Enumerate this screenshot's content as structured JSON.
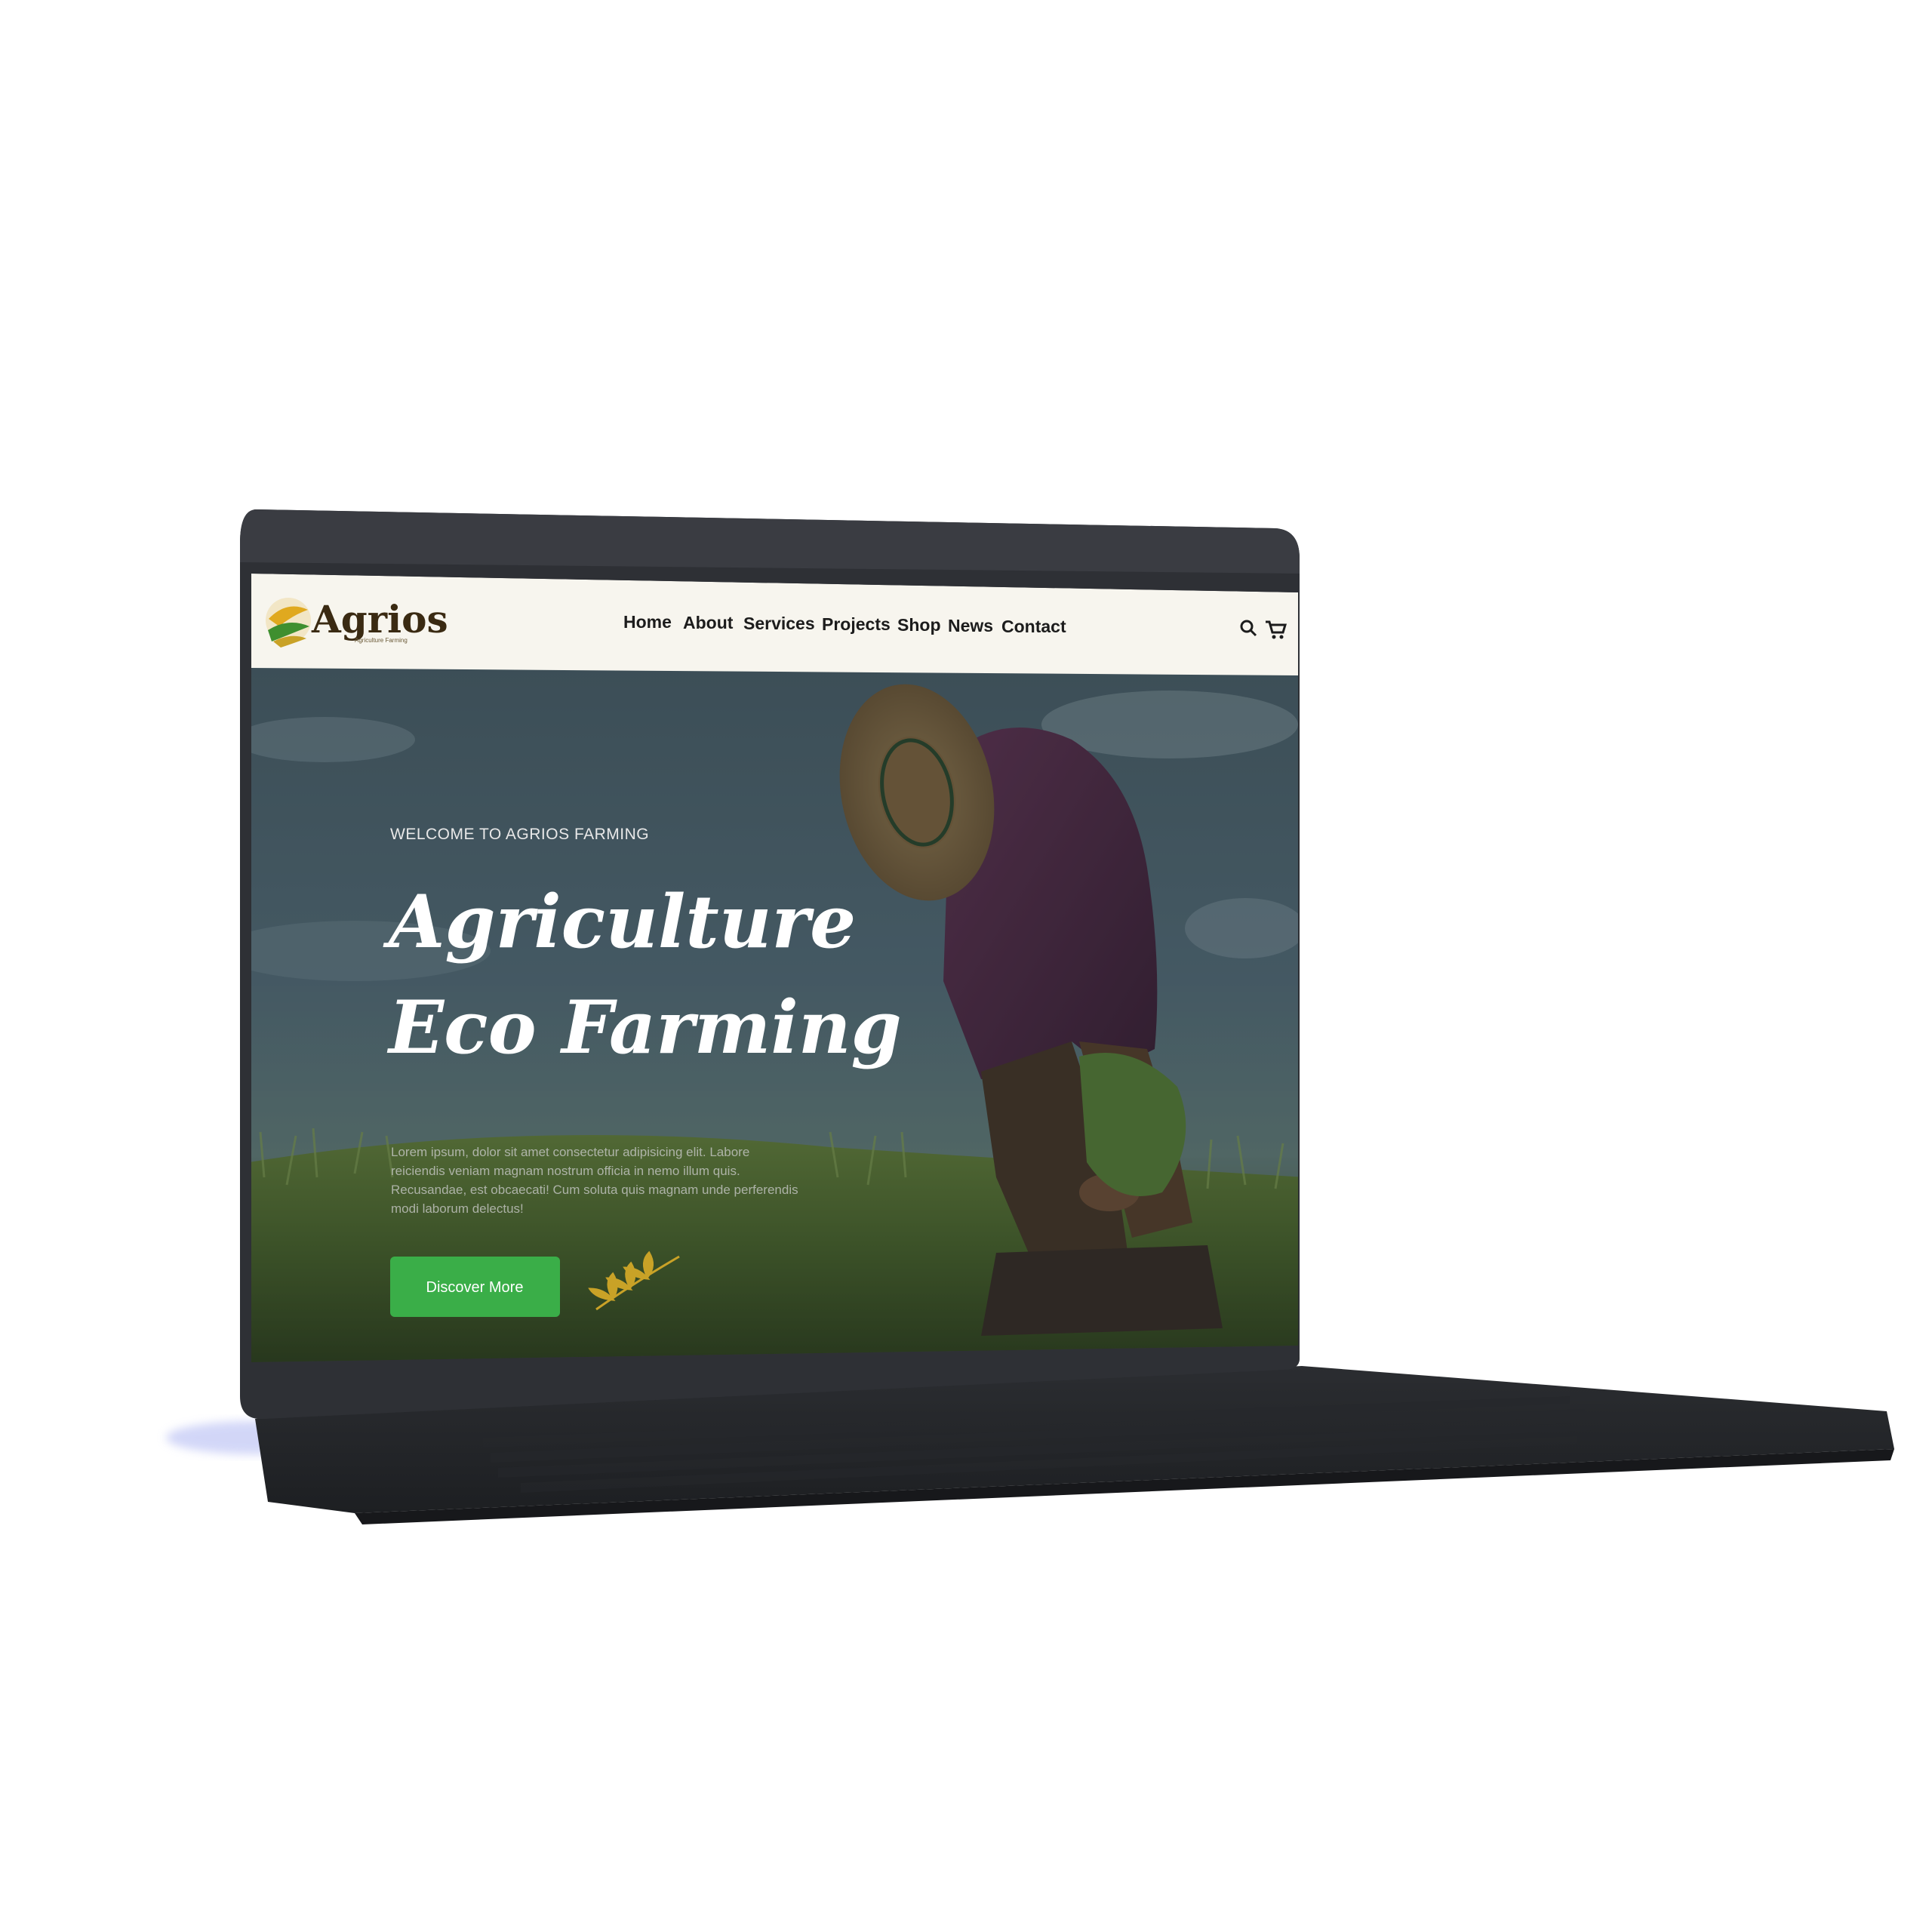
{
  "site": {
    "brand": "Agrios",
    "brand_subtitle": "Agriculture Farming"
  },
  "nav": {
    "items": [
      {
        "label": "Home"
      },
      {
        "label": "About"
      },
      {
        "label": "Services"
      },
      {
        "label": "Projects"
      },
      {
        "label": "Shop"
      },
      {
        "label": "News"
      },
      {
        "label": "Contact"
      }
    ],
    "icons": [
      "search-icon",
      "cart-icon"
    ]
  },
  "hero": {
    "tagline": "WELCOME TO AGRIOS FARMING",
    "title_line1": "Agriculture",
    "title_line2": "Eco Farming",
    "body_lines": [
      "Lorem ipsum, dolor sit amet consectetur adipisicing elit. Labore",
      "reiciendis veniam magnam nostrum officia in nemo illum quis.",
      "Recusandae, est obcaecati! Cum soluta quis magnam unde perferendis",
      "modi laborum delectus!"
    ],
    "cta_label": "Discover More"
  },
  "colors": {
    "header_bg": "#f7f5ee",
    "cta_green": "#3aae48",
    "laptop_body": "#2e3035",
    "accent_gold": "#c9a227",
    "logo_green": "#3f8f2f"
  }
}
